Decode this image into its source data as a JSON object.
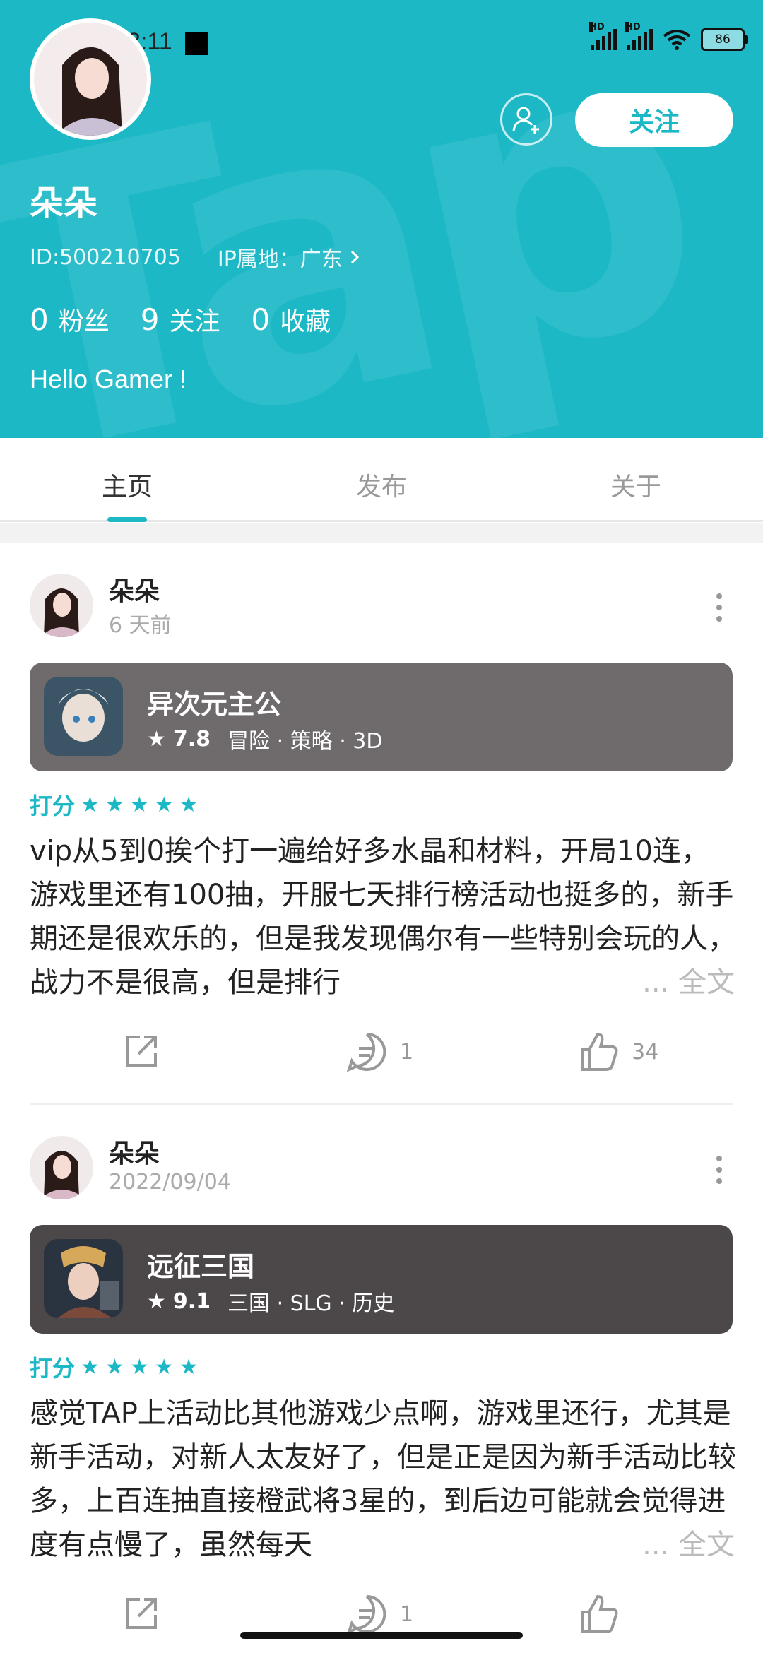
{
  "status_bar": {
    "time": "8:11",
    "battery": "86"
  },
  "profile": {
    "username": "朵朵",
    "id_text": "ID:500210705",
    "ip_text": "IP属地：广东",
    "follow_label": "关注",
    "stats": [
      {
        "num": "0",
        "label": "粉丝"
      },
      {
        "num": "9",
        "label": "关注"
      },
      {
        "num": "0",
        "label": "收藏"
      }
    ],
    "bio": "Hello Gamer !"
  },
  "tabs": [
    {
      "label": "主页"
    },
    {
      "label": "发布"
    },
    {
      "label": "关于"
    }
  ],
  "posts": [
    {
      "author": "朵朵",
      "time": "6 天前",
      "game": {
        "name": "异次元主公",
        "score": "7.8",
        "tags": "冒险 · 策略 · 3D",
        "color": "#6f6b6c"
      },
      "rating_label": "打分",
      "text": "vip从5到0挨个打一遍给好多水晶和材料，开局10连，游戏里还有100抽，开服七天排行榜活动也挺多的，新手期还是很欢乐的，但是我发现偶尔有一些特别会玩的人，战力不是很高，但是排行",
      "more_label": "... 全文",
      "comments": "1",
      "likes": "34"
    },
    {
      "author": "朵朵",
      "time": "2022/09/04",
      "game": {
        "name": "远征三国",
        "score": "9.1",
        "tags": "三国 · SLG · 历史",
        "color": "#4c4849"
      },
      "rating_label": "打分",
      "text": "感觉TAP上活动比其他游戏少点啊，游戏里还行，尤其是新手活动，对新人太友好了，但是正是因为新手活动比较多，上百连抽直接橙武将3星的，到后边可能就会觉得进度有点慢了，虽然每天",
      "more_label": "... 全文",
      "comments": "1",
      "likes": ""
    }
  ],
  "colors": {
    "accent": "#1db8c6",
    "header_bg": "#1db8c6"
  }
}
